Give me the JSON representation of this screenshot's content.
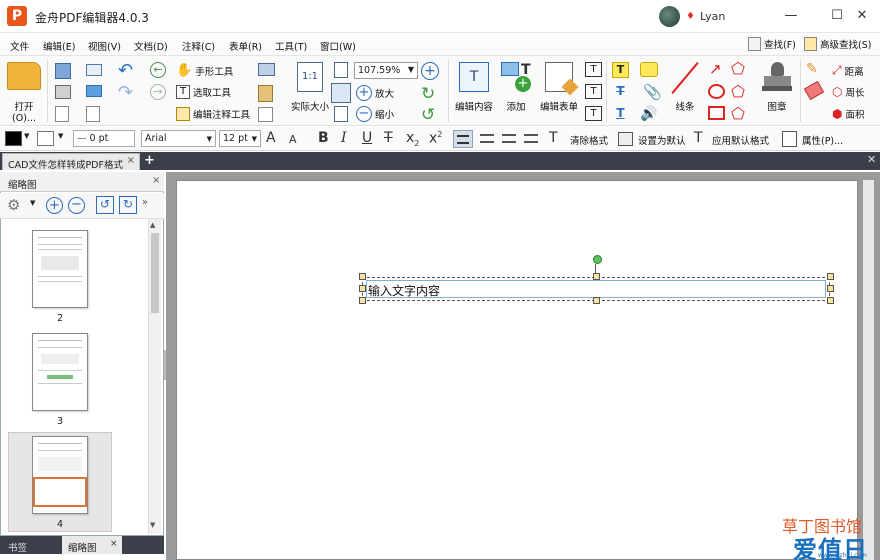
{
  "app": {
    "title": "金舟PDF编辑器4.0.3",
    "logo_letter": "P"
  },
  "user": {
    "name": "Lyan"
  },
  "window_controls": {
    "minimize": "—",
    "maximize": "☐",
    "close": "✕"
  },
  "menu": {
    "items": [
      "文件",
      "编辑(E)",
      "视图(V)",
      "文档(D)",
      "注释(C)",
      "表单(R)",
      "工具(T)",
      "窗口(W)"
    ],
    "find": "查找(F)",
    "advanced_find": "高级查找(S)"
  },
  "toolbar": {
    "open": "打开(O)...",
    "hand_tool": "手形工具",
    "select_tool": "选取工具",
    "edit_annot_tool": "编辑注释工具",
    "actual_size": "实际大小",
    "zoom_value": "107.59%",
    "zoom_in": "放大",
    "zoom_out": "缩小",
    "edit_content": "编辑内容",
    "add": "添加",
    "edit_form": "编辑表单",
    "line": "线条",
    "stamp": "图章",
    "distance": "距离",
    "perimeter": "周长",
    "area": "面积"
  },
  "format_bar": {
    "line_width": "0 pt",
    "font": "Arial",
    "font_size": "12 pt",
    "clear_format": "清除格式",
    "set_default": "设置为默认",
    "apply_default": "应用默认格式",
    "properties": "属性(P)..."
  },
  "document_tab": {
    "title": "CAD文件怎样转成PDF格式",
    "close": "×",
    "add": "+"
  },
  "panel": {
    "title": "缩略图",
    "close": "×",
    "pages": [
      "2",
      "3",
      "4"
    ],
    "bottom_tabs": [
      "书签",
      "缩略图"
    ]
  },
  "canvas": {
    "textbox_text": "输入文字内容"
  },
  "watermark": {
    "line1": "草丁图书馆",
    "line2": "爱值日",
    "line3": "www.aizhiri.com"
  },
  "colors": {
    "brand": "#e8561e",
    "tab_bar": "#3a3f4a",
    "workspace": "#9a9a9a",
    "handle": "#f7e39b"
  }
}
